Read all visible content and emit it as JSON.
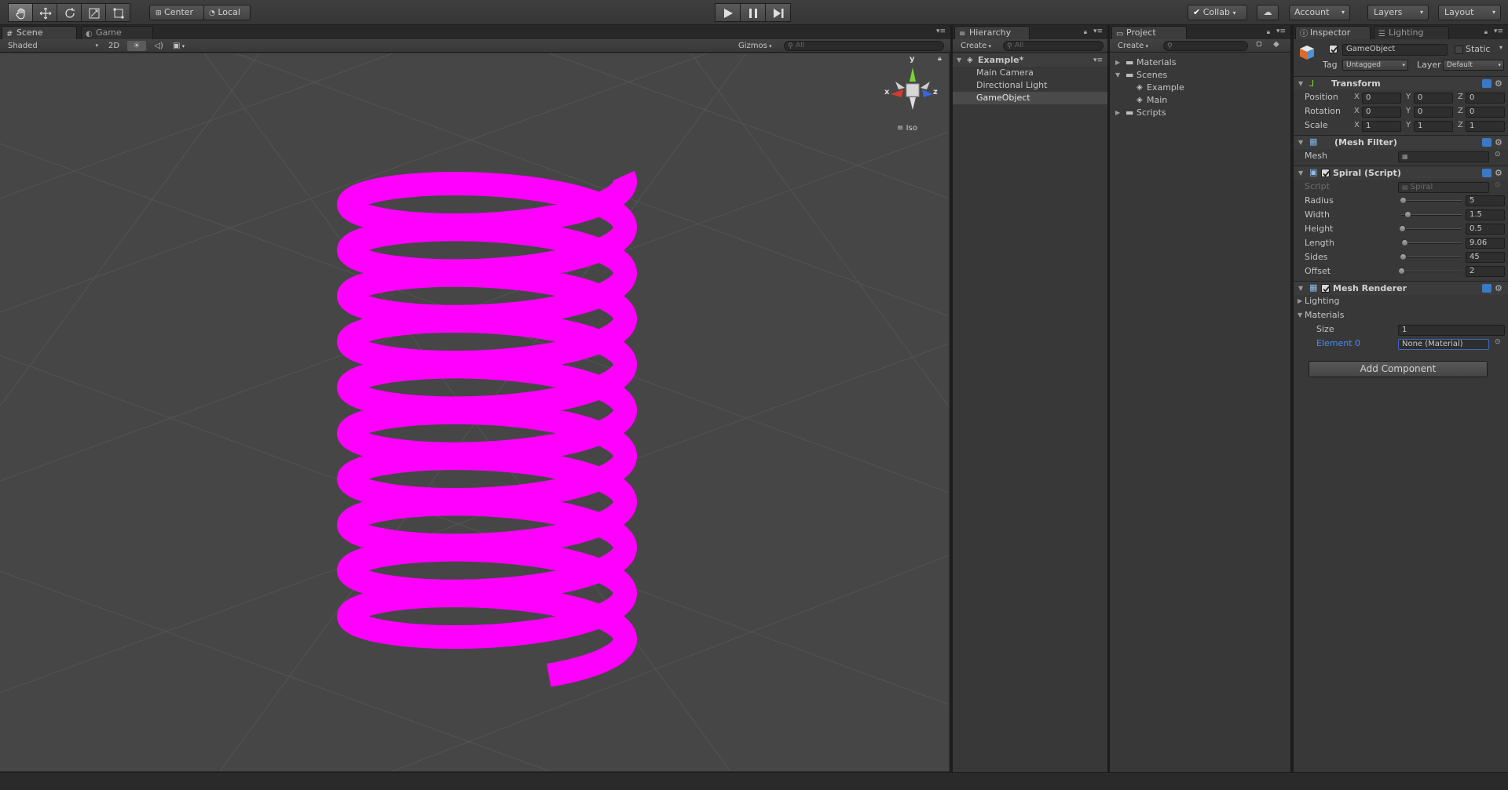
{
  "toolbar": {
    "tools": [
      "hand-icon",
      "move-icon",
      "rotate-icon",
      "scale-icon",
      "rect-icon"
    ],
    "pivot_label": "Center",
    "space_label": "Local",
    "collab_label": "Collab",
    "account_label": "Account",
    "layers_label": "Layers",
    "layout_label": "Layout"
  },
  "scene": {
    "tabs": [
      {
        "label": "Scene",
        "active": true
      },
      {
        "label": "Game",
        "active": false
      }
    ],
    "shading_mode": "Shaded",
    "mode_2d": "2D",
    "gizmos_label": "Gizmos",
    "search_placeholder": "All",
    "gizmo_axes": {
      "y": "y",
      "x": "x",
      "z": "z"
    },
    "projection_label": "Iso",
    "spiral_color": "#ff00ff"
  },
  "hierarchy": {
    "tab": "Hierarchy",
    "create_label": "Create",
    "search_placeholder": "All",
    "scene_name": "Example*",
    "items": [
      "Main Camera",
      "Directional Light",
      "GameObject"
    ],
    "selected": "GameObject"
  },
  "project": {
    "tab": "Project",
    "create_label": "Create",
    "folders": [
      {
        "label": "Materials",
        "expanded": false
      },
      {
        "label": "Scenes",
        "expanded": true,
        "children": [
          "Example",
          "Main"
        ]
      },
      {
        "label": "Scripts",
        "expanded": false
      }
    ]
  },
  "inspector": {
    "tabs": [
      {
        "label": "Inspector",
        "active": true
      },
      {
        "label": "Lighting",
        "active": false
      }
    ],
    "object_name": "GameObject",
    "static_label": "Static",
    "tag_label": "Tag",
    "tag_value": "Untagged",
    "layer_label": "Layer",
    "layer_value": "Default",
    "transform": {
      "title": "Transform",
      "position": {
        "label": "Position",
        "x": "0",
        "y": "0",
        "z": "0"
      },
      "rotation": {
        "label": "Rotation",
        "x": "0",
        "y": "0",
        "z": "0"
      },
      "scale": {
        "label": "Scale",
        "x": "1",
        "y": "1",
        "z": "1"
      }
    },
    "mesh_filter": {
      "title": "(Mesh Filter)",
      "mesh_label": "Mesh",
      "mesh_value": ""
    },
    "spiral": {
      "title": "Spiral (Script)",
      "script_label": "Script",
      "script_value": "Spiral",
      "fields": [
        {
          "label": "Radius",
          "value": "5",
          "fraction": 0.02
        },
        {
          "label": "Width",
          "value": "1.5",
          "fraction": 0.1
        },
        {
          "label": "Height",
          "value": "0.5",
          "fraction": 0.01
        },
        {
          "label": "Length",
          "value": "9.06",
          "fraction": 0.05
        },
        {
          "label": "Sides",
          "value": "45",
          "fraction": 0.02
        },
        {
          "label": "Offset",
          "value": "2",
          "fraction": 0.0
        }
      ]
    },
    "mesh_renderer": {
      "title": "Mesh Renderer",
      "lighting_label": "Lighting",
      "materials_label": "Materials",
      "size_label": "Size",
      "size_value": "1",
      "element_label": "Element 0",
      "element_value": "None (Material)"
    },
    "add_component_label": "Add Component"
  }
}
